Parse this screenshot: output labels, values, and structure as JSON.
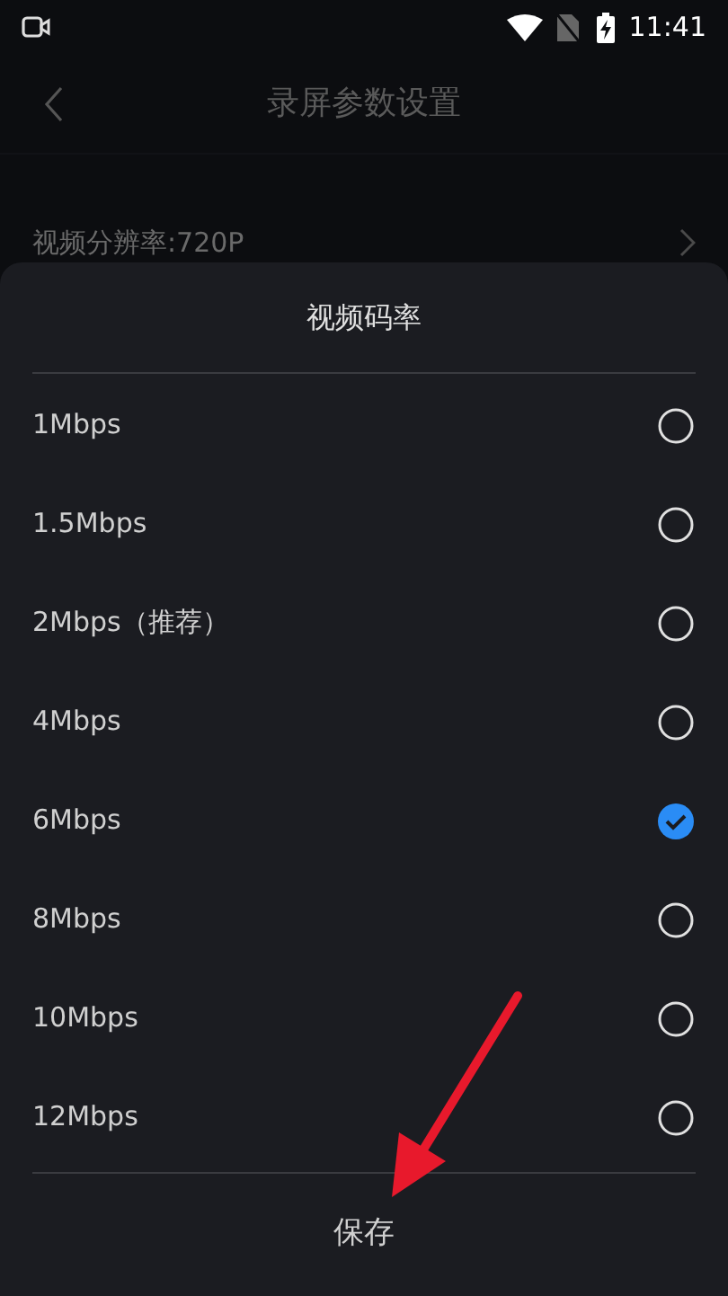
{
  "status_bar": {
    "time": "11:41"
  },
  "header": {
    "title": "录屏参数设置"
  },
  "settings": [
    {
      "label": "视频分辨率:720P"
    }
  ],
  "sheet": {
    "title": "视频码率",
    "options": [
      {
        "label": "1Mbps",
        "selected": false
      },
      {
        "label": "1.5Mbps",
        "selected": false
      },
      {
        "label": "2Mbps（推荐）",
        "selected": false
      },
      {
        "label": "4Mbps",
        "selected": false
      },
      {
        "label": "6Mbps",
        "selected": true
      },
      {
        "label": "8Mbps",
        "selected": false
      },
      {
        "label": "10Mbps",
        "selected": false
      },
      {
        "label": "12Mbps",
        "selected": false
      }
    ],
    "save_button": "保存"
  }
}
